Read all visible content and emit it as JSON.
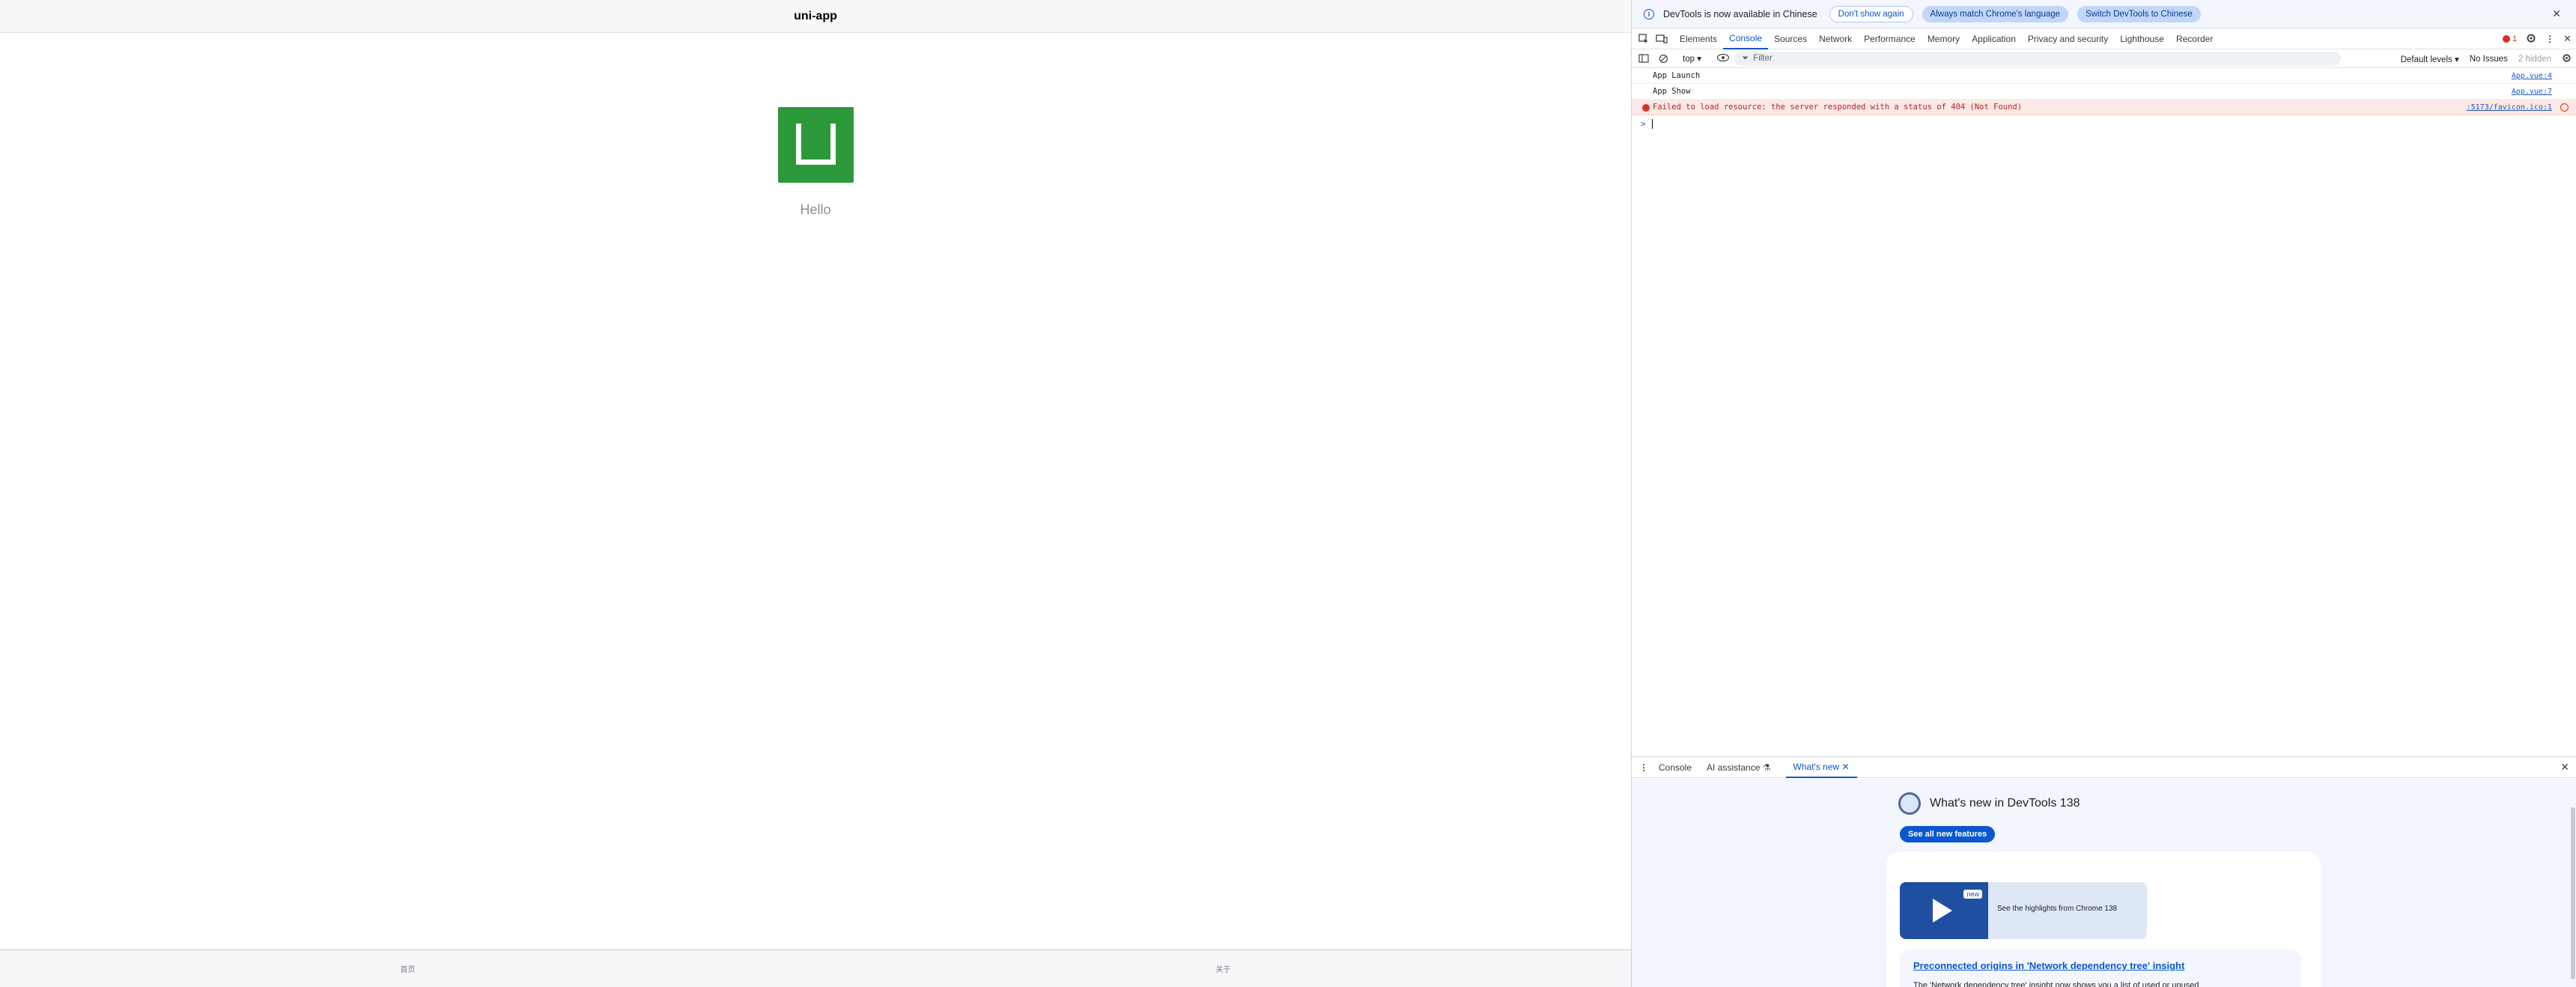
{
  "app": {
    "title": "uni-app",
    "greeting": "Hello",
    "tabbar": [
      "首页",
      "关于"
    ]
  },
  "devtools": {
    "infobar": {
      "message": "DevTools is now available in Chinese",
      "dont_show": "Don't show again",
      "match_lang": "Always match Chrome's language",
      "switch_lang": "Switch DevTools to Chinese"
    },
    "tabs": [
      "Elements",
      "Console",
      "Sources",
      "Network",
      "Performance",
      "Memory",
      "Application",
      "Privacy and security",
      "Lighthouse",
      "Recorder"
    ],
    "active_tab": "Console",
    "error_count": "1",
    "toolbar": {
      "context": "top",
      "filter_placeholder": "Filter",
      "levels": "Default levels",
      "issues": "No Issues",
      "hidden": "2 hidden"
    },
    "console": [
      {
        "text": "App Launch",
        "source": "App.vue:4",
        "type": "log"
      },
      {
        "text": "App Show",
        "source": "App.vue:7",
        "type": "log"
      },
      {
        "text": "Failed to load resource: the server responded with a status of 404 (Not Found)",
        "source": ":5173/favicon.ico:1",
        "type": "error"
      }
    ],
    "drawer": {
      "tabs": [
        "Console",
        "AI assistance",
        "What's new"
      ],
      "whats_new_title": "What's new in DevTools 138",
      "see_all": "See all new features",
      "video_badge": "new",
      "video_caption": "See the highlights from Chrome 138",
      "feature_title": "Preconnected origins in 'Network dependency tree' insight",
      "feature_desc": "The 'Network dependency tree' insight now shows you a list of used or unused"
    }
  }
}
